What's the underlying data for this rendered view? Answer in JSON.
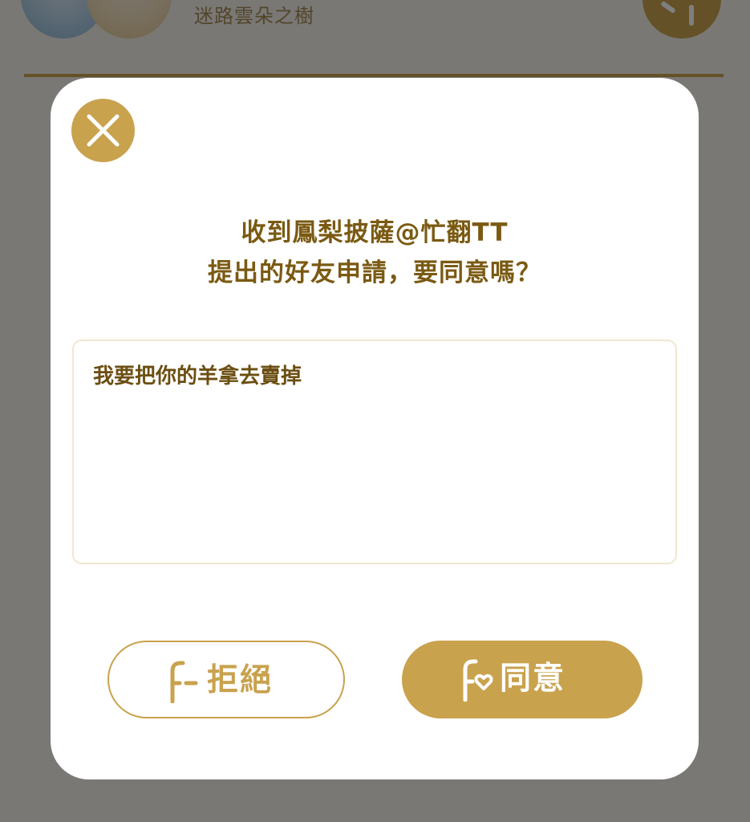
{
  "background": {
    "location_name": "迷路雲朵之樹"
  },
  "dialog": {
    "title_line1": "收到鳳梨披薩@忙翻TT",
    "title_line2": "提出的好友申請，要同意嗎？",
    "message": "我要把你的羊拿去賣掉",
    "reject_label": "拒絕",
    "accept_label": "同意"
  },
  "icons": {
    "close": "close-icon",
    "reject": "friend-remove-icon",
    "accept": "friend-heart-icon"
  },
  "colors": {
    "accent": "#c9a24e",
    "title_text": "#7a5a12",
    "message_border": "#f1e6d1",
    "overlay": "rgba(0,0,0,0.5)"
  }
}
